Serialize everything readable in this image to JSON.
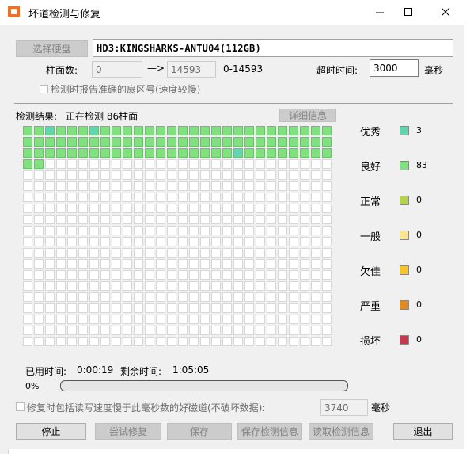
{
  "window": {
    "title": "坏道检测与修复",
    "minimize_icon": "minimize-icon",
    "maximize_icon": "maximize-icon",
    "close_icon": "close-icon"
  },
  "disk": {
    "select_label": "选择硬盘",
    "name": "HD3:KINGSHARKS-ANTU04(112GB)"
  },
  "cylinders": {
    "label": "柱面数:",
    "from": "0",
    "arrow": "—>",
    "to": "14593",
    "range": "0-14593"
  },
  "timeout": {
    "label": "超时时间:",
    "value": "3000",
    "unit": "毫秒"
  },
  "option_accurate_sector": {
    "label": "检测时报告准确的扇区号(速度较慢)",
    "checked": false
  },
  "result": {
    "label": "检测结果:",
    "status": "正在检测 86柱面",
    "detail_button": "详细信息"
  },
  "grid": {
    "columns": 28,
    "rows": 20,
    "done_count": 86,
    "excellent_positions": [
      2,
      6,
      75
    ]
  },
  "legend": [
    {
      "label": "优秀",
      "count": "3",
      "color": "#5fd6b0",
      "icon": "excellent-swatch"
    },
    {
      "label": "良好",
      "count": "83",
      "color": "#7fe27f",
      "icon": "good-swatch"
    },
    {
      "label": "正常",
      "count": "0",
      "color": "#b5d24a",
      "icon": "normal-swatch"
    },
    {
      "label": "一般",
      "count": "0",
      "color": "#fde58f",
      "icon": "fair-swatch"
    },
    {
      "label": "欠佳",
      "count": "0",
      "color": "#f7c52b",
      "icon": "poor-swatch"
    },
    {
      "label": "严重",
      "count": "0",
      "color": "#e38a1e",
      "icon": "severe-swatch"
    },
    {
      "label": "损坏",
      "count": "0",
      "color": "#c8384a",
      "icon": "damaged-swatch"
    }
  ],
  "time": {
    "elapsed_label": "已用时间:",
    "elapsed": "0:00:19",
    "remaining_label": "剩余时间:",
    "remaining": "1:05:05"
  },
  "progress": {
    "text": "0%",
    "fraction": 0.0
  },
  "repair_option": {
    "label": "修复时包括读写速度慢于此毫秒数的好磁道(不破坏数据):",
    "value": "3740",
    "unit": "毫秒",
    "checked": false
  },
  "buttons": {
    "stop": "停止",
    "try_repair": "尝试修复",
    "save": "保存",
    "save_result": "保存检测信息",
    "read_result": "读取检测信息",
    "exit": "退出"
  }
}
